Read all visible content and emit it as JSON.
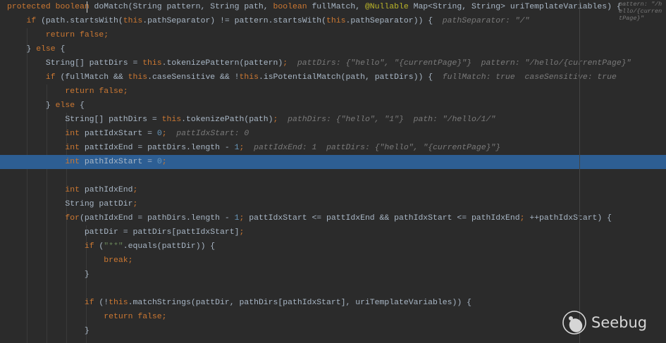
{
  "editor": {
    "lines": [
      [
        [
          "kw",
          "protected boolean "
        ],
        [
          "t",
          "doMatch(String pattern, String path, "
        ],
        [
          "kw",
          "boolean "
        ],
        [
          "t",
          "fullMatch, "
        ],
        [
          "ann",
          "@Nullable "
        ],
        [
          "t",
          "Map<String, String> uriTemplateVariables) {  "
        ],
        [
          "hint",
          "pattern: \"/hello/{currentPage}\""
        ]
      ],
      [
        [
          "t",
          "    "
        ],
        [
          "kw",
          "if "
        ],
        [
          "t",
          "(path.startsWith("
        ],
        [
          "kw",
          "this"
        ],
        [
          "t",
          ".pathSeparator) != pattern.startsWith("
        ],
        [
          "kw",
          "this"
        ],
        [
          "t",
          ".pathSeparator)) {  "
        ],
        [
          "hint",
          "pathSeparator: \"/\""
        ]
      ],
      [
        [
          "t",
          "        "
        ],
        [
          "kw",
          "return false;"
        ]
      ],
      [
        [
          "t",
          "    } "
        ],
        [
          "kw",
          "else "
        ],
        [
          "t",
          "{"
        ]
      ],
      [
        [
          "t",
          "        String[] pattDirs = "
        ],
        [
          "kw",
          "this"
        ],
        [
          "t",
          ".tokenizePattern(pattern)"
        ],
        [
          "kw",
          ";"
        ],
        [
          "t",
          "  "
        ],
        [
          "hint",
          "pattDirs: {\"hello\", \"{currentPage}\"}  pattern: \"/hello/{currentPage}\""
        ]
      ],
      [
        [
          "t",
          "        "
        ],
        [
          "kw",
          "if "
        ],
        [
          "t",
          "(fullMatch && "
        ],
        [
          "kw",
          "this"
        ],
        [
          "t",
          ".caseSensitive && !"
        ],
        [
          "kw",
          "this"
        ],
        [
          "t",
          ".isPotentialMatch(path, pattDirs)) {  "
        ],
        [
          "hint",
          "fullMatch: true  caseSensitive: true"
        ]
      ],
      [
        [
          "t",
          "            "
        ],
        [
          "kw",
          "return false;"
        ]
      ],
      [
        [
          "t",
          "        } "
        ],
        [
          "kw",
          "else "
        ],
        [
          "t",
          "{"
        ]
      ],
      [
        [
          "t",
          "            String[] pathDirs = "
        ],
        [
          "kw",
          "this"
        ],
        [
          "t",
          ".tokenizePath(path)"
        ],
        [
          "kw",
          ";"
        ],
        [
          "t",
          "  "
        ],
        [
          "hint",
          "pathDirs: {\"hello\", \"1\"}  path: \"/hello/1/\""
        ]
      ],
      [
        [
          "t",
          "            "
        ],
        [
          "kw",
          "int "
        ],
        [
          "t",
          "pattIdxStart = "
        ],
        [
          "num",
          "0"
        ],
        [
          "kw",
          ";"
        ],
        [
          "t",
          "  "
        ],
        [
          "hint",
          "pattIdxStart: 0"
        ]
      ],
      [
        [
          "t",
          "            "
        ],
        [
          "kw",
          "int "
        ],
        [
          "t",
          "pattIdxEnd = pattDirs.length - "
        ],
        [
          "num",
          "1"
        ],
        [
          "kw",
          ";"
        ],
        [
          "t",
          "  "
        ],
        [
          "hint",
          "pattIdxEnd: 1  pattDirs: {\"hello\", \"{currentPage}\"}"
        ]
      ],
      [
        [
          "t",
          "            "
        ],
        [
          "kw",
          "int "
        ],
        [
          "t",
          "pathIdxStart = "
        ],
        [
          "num",
          "0"
        ],
        [
          "kw",
          ";"
        ]
      ],
      [
        [
          "t",
          ""
        ]
      ],
      [
        [
          "t",
          "            "
        ],
        [
          "kw",
          "int "
        ],
        [
          "t",
          "pathIdxEnd"
        ],
        [
          "kw",
          ";"
        ]
      ],
      [
        [
          "t",
          "            String pattDir"
        ],
        [
          "kw",
          ";"
        ]
      ],
      [
        [
          "t",
          "            "
        ],
        [
          "kw",
          "for"
        ],
        [
          "t",
          "(pathIdxEnd = pathDirs.length - "
        ],
        [
          "num",
          "1"
        ],
        [
          "kw",
          "; "
        ],
        [
          "t",
          "pattIdxStart <= pattIdxEnd && pathIdxStart <= pathIdxEnd"
        ],
        [
          "kw",
          "; "
        ],
        [
          "t",
          "++pathIdxStart) {"
        ]
      ],
      [
        [
          "t",
          "                pattDir = pattDirs[pattIdxStart]"
        ],
        [
          "kw",
          ";"
        ]
      ],
      [
        [
          "t",
          "                "
        ],
        [
          "kw",
          "if "
        ],
        [
          "t",
          "("
        ],
        [
          "str",
          "\"**\""
        ],
        [
          "t",
          ".equals(pattDir)) {"
        ]
      ],
      [
        [
          "t",
          "                    "
        ],
        [
          "kw",
          "break;"
        ]
      ],
      [
        [
          "t",
          "                }"
        ]
      ],
      [
        [
          "t",
          ""
        ]
      ],
      [
        [
          "t",
          "                "
        ],
        [
          "kw",
          "if "
        ],
        [
          "t",
          "(!"
        ],
        [
          "kw",
          "this"
        ],
        [
          "t",
          ".matchStrings(pattDir, pathDirs[pathIdxStart], uriTemplateVariables)) {"
        ]
      ],
      [
        [
          "t",
          "                    "
        ],
        [
          "kw",
          "return false;"
        ]
      ],
      [
        [
          "t",
          "                }"
        ]
      ]
    ],
    "highlighted_line": 11
  },
  "watermark": {
    "text": "Seebug"
  }
}
